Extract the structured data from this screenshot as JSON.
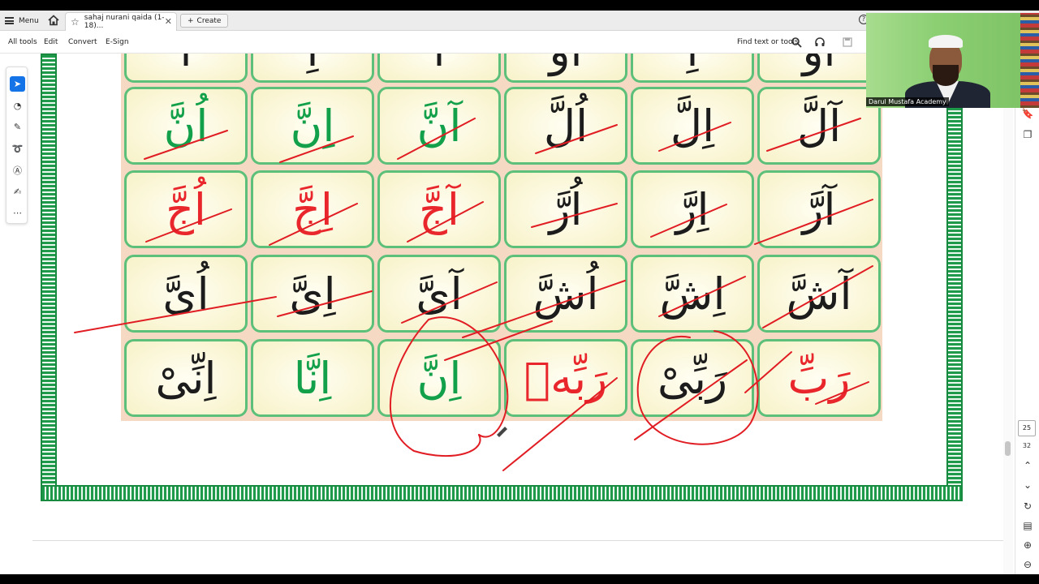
{
  "tabbar": {
    "menu_label": "Menu",
    "tab_title": "sahaj nurani qaida (1-18)...",
    "create_label": "Create"
  },
  "toolbar": {
    "items": [
      "All tools",
      "Edit",
      "Convert",
      "E-Sign"
    ],
    "find_label": "Find text or tools"
  },
  "page_nav": {
    "current_page": "25",
    "total_pages": "32"
  },
  "webcam": {
    "label": "Darul Mustafa Academy"
  },
  "qaida": {
    "top_row": [
      {
        "text": "اَ",
        "color": "black"
      },
      {
        "text": "اِ",
        "color": "black"
      },
      {
        "text": "اَ",
        "color": "black"
      },
      {
        "text": "اُو",
        "color": "black"
      },
      {
        "text": "اِ",
        "color": "black"
      },
      {
        "text": "اُو",
        "color": "black"
      }
    ],
    "rows": [
      [
        {
          "text": "اُنَّ",
          "color": "green"
        },
        {
          "text": "اِنَّ",
          "color": "green"
        },
        {
          "text": "آنَّ",
          "color": "green"
        },
        {
          "text": "اُلَّ",
          "color": "black"
        },
        {
          "text": "اِلَّ",
          "color": "black"
        },
        {
          "text": "آلَّ",
          "color": "black"
        }
      ],
      [
        {
          "text": "اُجَّ",
          "color": "red"
        },
        {
          "text": "اِجَّ",
          "color": "red"
        },
        {
          "text": "آجَّ",
          "color": "red"
        },
        {
          "text": "اُرَّ",
          "color": "black"
        },
        {
          "text": "اِرَّ",
          "color": "black"
        },
        {
          "text": "آرَّ",
          "color": "black"
        }
      ],
      [
        {
          "text": "اُىَّ",
          "color": "black"
        },
        {
          "text": "اِىَّ",
          "color": "black"
        },
        {
          "text": "آىَّ",
          "color": "black"
        },
        {
          "text": "اُشَّ",
          "color": "black"
        },
        {
          "text": "اِشَّ",
          "color": "black"
        },
        {
          "text": "آشَّ",
          "color": "black"
        }
      ],
      [
        {
          "text": "اِنِّىْ",
          "color": "black"
        },
        {
          "text": "اِنَّا",
          "color": "green"
        },
        {
          "text": "اِنَّ",
          "color": "green"
        },
        {
          "text": "رَبِّهٖ",
          "color": "red"
        },
        {
          "text": "رَبِّىْ",
          "color": "black"
        },
        {
          "text": "رَبِّ",
          "color": "red"
        }
      ]
    ]
  }
}
